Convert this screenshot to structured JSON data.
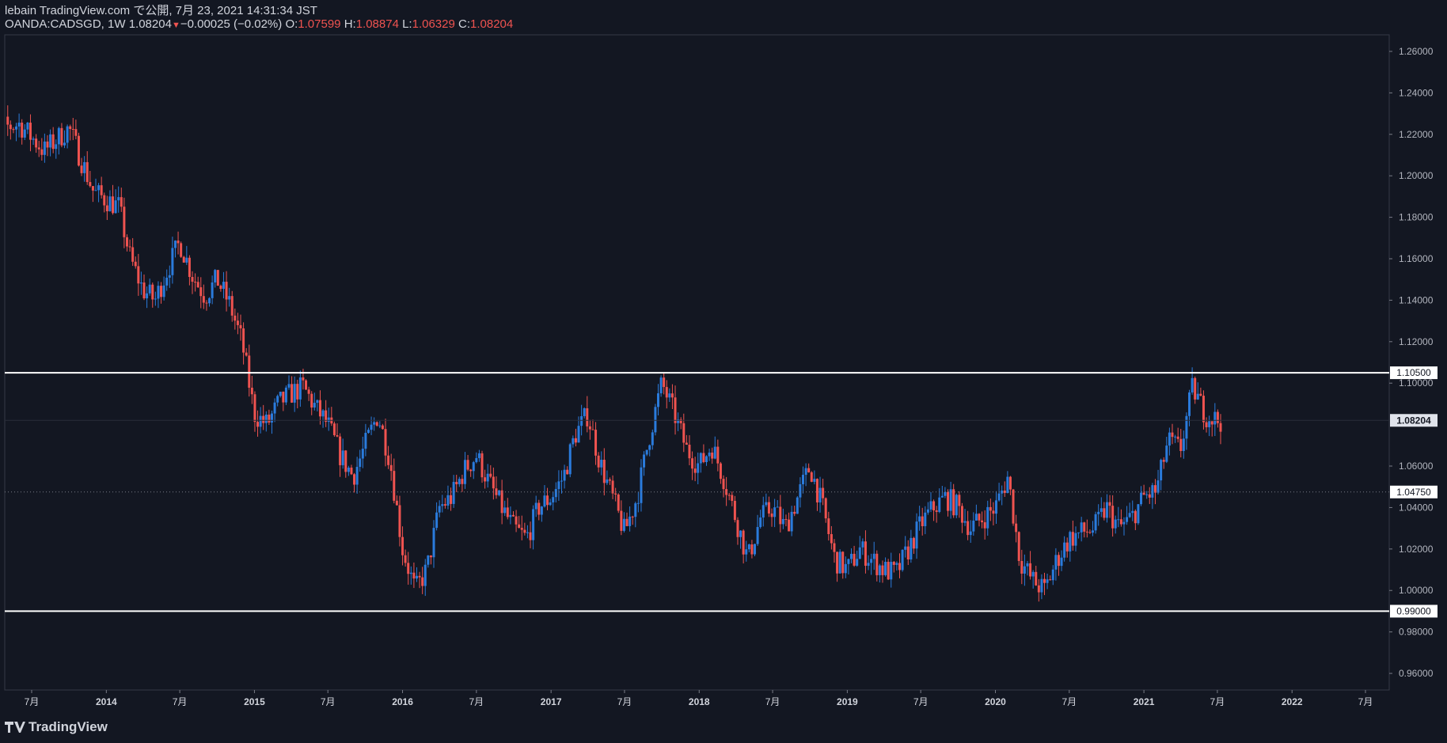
{
  "header": {
    "line1": "lebain TradingView.com で公開, 7月 23, 2021 14:31:34 JST",
    "symbol": "OANDA:CADSGD, 1W",
    "last": "1.08204",
    "change": "−0.00025 (−0.02%)",
    "o_label": "O:",
    "o": "1.07599",
    "h_label": "H:",
    "h": "1.08874",
    "l_label": "L:",
    "l": "1.06329",
    "c_label": "C:",
    "c": "1.08204"
  },
  "footer": {
    "brand": "TradingView",
    "logo": "tradingview-logo-icon"
  },
  "colors": {
    "background": "#131722",
    "up": "#2a7bdc",
    "down": "#ef5350",
    "line": "#ffffff",
    "text": "#d1d4dc"
  },
  "chart_data": {
    "type": "candlestick",
    "symbol": "OANDA:CADSGD",
    "interval": "1W",
    "ylim": [
      0.952,
      1.268
    ],
    "y_ticks": [
      "1.26000",
      "1.24000",
      "1.22000",
      "1.20000",
      "1.18000",
      "1.16000",
      "1.14000",
      "1.12000",
      "1.10000",
      "1.06000",
      "1.04000",
      "1.02000",
      "1.00000",
      "0.98000",
      "0.96000"
    ],
    "x_ticks": [
      {
        "label": "7月",
        "x": "2013-07"
      },
      {
        "label": "2014",
        "x": "2014-01"
      },
      {
        "label": "7月",
        "x": "2014-07"
      },
      {
        "label": "2015",
        "x": "2015-01"
      },
      {
        "label": "7月",
        "x": "2015-07"
      },
      {
        "label": "2016",
        "x": "2016-01"
      },
      {
        "label": "7月",
        "x": "2016-07"
      },
      {
        "label": "2017",
        "x": "2017-01"
      },
      {
        "label": "7月",
        "x": "2017-07"
      },
      {
        "label": "2018",
        "x": "2018-01"
      },
      {
        "label": "7月",
        "x": "2018-07"
      },
      {
        "label": "2019",
        "x": "2019-01"
      },
      {
        "label": "7月",
        "x": "2019-07"
      },
      {
        "label": "2020",
        "x": "2020-01"
      },
      {
        "label": "7月",
        "x": "2020-07"
      },
      {
        "label": "2021",
        "x": "2021-01"
      },
      {
        "label": "7月",
        "x": "2021-07"
      },
      {
        "label": "2022",
        "x": "2022-01"
      },
      {
        "label": "7月",
        "x": "2022-07"
      }
    ],
    "horizontal_lines": [
      {
        "value": 1.105,
        "label": "1.10500",
        "style": "solid"
      },
      {
        "value": 0.99,
        "label": "0.99000",
        "style": "solid"
      },
      {
        "value": 1.0475,
        "label": "1.04750",
        "style": "dotted"
      }
    ],
    "last_price": {
      "value": 1.08204,
      "label": "1.08204"
    },
    "close_path": [
      [
        "2013-03",
        1.221
      ],
      [
        "2013-06",
        1.225
      ],
      [
        "2013-08",
        1.212
      ],
      [
        "2013-10",
        1.223
      ],
      [
        "2013-12",
        1.192
      ],
      [
        "2014-02",
        1.185
      ],
      [
        "2014-03",
        1.16
      ],
      [
        "2014-04",
        1.145
      ],
      [
        "2014-05",
        1.14
      ],
      [
        "2014-06",
        1.155
      ],
      [
        "2014-07",
        1.168
      ],
      [
        "2014-08",
        1.152
      ],
      [
        "2014-09",
        1.142
      ],
      [
        "2014-10",
        1.15
      ],
      [
        "2014-11",
        1.138
      ],
      [
        "2014-12",
        1.12
      ],
      [
        "2015-01",
        1.085
      ],
      [
        "2015-02",
        1.08
      ],
      [
        "2015-03",
        1.09
      ],
      [
        "2015-04",
        1.095
      ],
      [
        "2015-05",
        1.098
      ],
      [
        "2015-06",
        1.088
      ],
      [
        "2015-07",
        1.08
      ],
      [
        "2015-08",
        1.065
      ],
      [
        "2015-09",
        1.055
      ],
      [
        "2015-10",
        1.07
      ],
      [
        "2015-11",
        1.085
      ],
      [
        "2015-12",
        1.063
      ],
      [
        "2016-01",
        1.02
      ],
      [
        "2016-02",
        1.0
      ],
      [
        "2016-03",
        1.01
      ],
      [
        "2016-04",
        1.04
      ],
      [
        "2016-05",
        1.045
      ],
      [
        "2016-06",
        1.058
      ],
      [
        "2016-07",
        1.065
      ],
      [
        "2016-08",
        1.052
      ],
      [
        "2016-09",
        1.04
      ],
      [
        "2016-10",
        1.03
      ],
      [
        "2016-11",
        1.025
      ],
      [
        "2016-12",
        1.04
      ],
      [
        "2017-01",
        1.045
      ],
      [
        "2017-02",
        1.055
      ],
      [
        "2017-03",
        1.075
      ],
      [
        "2017-04",
        1.085
      ],
      [
        "2017-05",
        1.062
      ],
      [
        "2017-06",
        1.045
      ],
      [
        "2017-07",
        1.028
      ],
      [
        "2017-08",
        1.045
      ],
      [
        "2017-09",
        1.075
      ],
      [
        "2017-10",
        1.1
      ],
      [
        "2017-11",
        1.085
      ],
      [
        "2017-12",
        1.068
      ],
      [
        "2018-01",
        1.06
      ],
      [
        "2018-02",
        1.07
      ],
      [
        "2018-03",
        1.055
      ],
      [
        "2018-04",
        1.035
      ],
      [
        "2018-05",
        1.015
      ],
      [
        "2018-06",
        1.035
      ],
      [
        "2018-07",
        1.04
      ],
      [
        "2018-08",
        1.03
      ],
      [
        "2018-09",
        1.045
      ],
      [
        "2018-10",
        1.06
      ],
      [
        "2018-11",
        1.04
      ],
      [
        "2018-12",
        1.015
      ],
      [
        "2019-01",
        1.01
      ],
      [
        "2019-02",
        1.02
      ],
      [
        "2019-03",
        1.015
      ],
      [
        "2019-04",
        1.01
      ],
      [
        "2019-05",
        1.008
      ],
      [
        "2019-06",
        1.02
      ],
      [
        "2019-07",
        1.032
      ],
      [
        "2019-08",
        1.04
      ],
      [
        "2019-09",
        1.045
      ],
      [
        "2019-10",
        1.04
      ],
      [
        "2019-11",
        1.03
      ],
      [
        "2019-12",
        1.035
      ],
      [
        "2020-01",
        1.04
      ],
      [
        "2020-02",
        1.055
      ],
      [
        "2020-03",
        1.015
      ],
      [
        "2020-04",
        1.005
      ],
      [
        "2020-05",
        1.0
      ],
      [
        "2020-06",
        1.015
      ],
      [
        "2020-07",
        1.025
      ],
      [
        "2020-08",
        1.028
      ],
      [
        "2020-09",
        1.03
      ],
      [
        "2020-10",
        1.04
      ],
      [
        "2020-11",
        1.03
      ],
      [
        "2020-12",
        1.035
      ],
      [
        "2021-01",
        1.045
      ],
      [
        "2021-02",
        1.048
      ],
      [
        "2021-03",
        1.072
      ],
      [
        "2021-04",
        1.068
      ],
      [
        "2021-05",
        1.098
      ],
      [
        "2021-06",
        1.085
      ],
      [
        "2021-07",
        1.082
      ]
    ]
  }
}
